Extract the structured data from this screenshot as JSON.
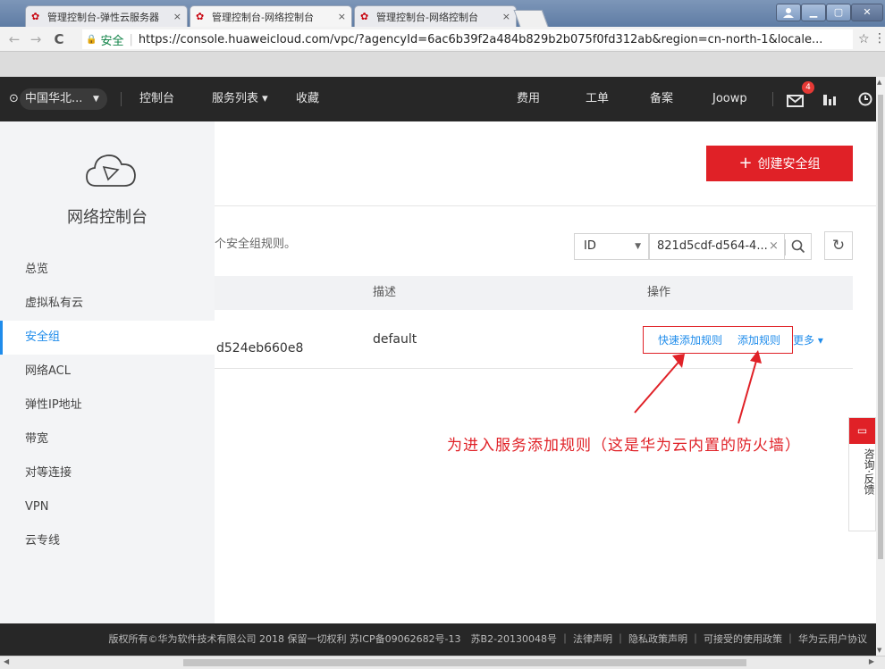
{
  "browser": {
    "tabs": [
      {
        "label": "管理控制台-弹性云服务器",
        "close": "×"
      },
      {
        "label": "管理控制台-网络控制台",
        "close": "×"
      },
      {
        "label": "管理控制台-网络控制台",
        "close": "×"
      }
    ],
    "nav": {
      "back": "←",
      "forward": "→",
      "reload": "C"
    },
    "secure_label": "安全",
    "url": "https://console.huaweicloud.com/vpc/?agencyId=6ac6b39f2a484b829b2b075f0fd312ab&region=cn-north-1&locale...",
    "star": "☆",
    "menu": "⋮"
  },
  "topnav": {
    "region": "中国华北...",
    "console": "控制台",
    "services": "服务列表 ▾",
    "favorites": "收藏",
    "fees": "费用",
    "tickets": "工单",
    "icp": "备案",
    "user": "Joowp",
    "message_count": "4"
  },
  "sidebar": {
    "title": "网络控制台",
    "items": [
      {
        "label": "总览"
      },
      {
        "label": "虚拟私有云"
      },
      {
        "label": "安全组"
      },
      {
        "label": "网络ACL"
      },
      {
        "label": "弹性IP地址"
      },
      {
        "label": "带宽"
      },
      {
        "label": "对等连接"
      },
      {
        "label": "VPN"
      },
      {
        "label": "云专线"
      }
    ]
  },
  "main": {
    "create_button": "创建安全组",
    "create_plus": "+",
    "description": "个安全组规则。",
    "filter": {
      "field": "ID",
      "value": "821d5cdf-d564-4...",
      "clear": "×"
    },
    "table": {
      "headers": {
        "desc": "描述",
        "ops": "操作"
      },
      "row": {
        "id_suffix": "d524eb660e8",
        "desc": "default",
        "op_quick_add": "快速添加规则",
        "op_add": "添加规则",
        "op_more": "更多 ▾"
      }
    },
    "annotation": "为进入服务添加规则（这是华为云内置的防火墙）"
  },
  "feedback": {
    "label": "咨询·反馈"
  },
  "footer": {
    "text": "版权所有©华为软件技术有限公司 2018 保留一切权利 苏ICP备09062682号-13　苏B2-20130048号 ｜ 法律声明 ｜ 隐私政策声明 ｜ 可接受的使用政策 ｜ 华为云用户协议"
  },
  "colors": {
    "accent": "#e02127",
    "link": "#1f8ceb",
    "topbar": "#272727"
  }
}
